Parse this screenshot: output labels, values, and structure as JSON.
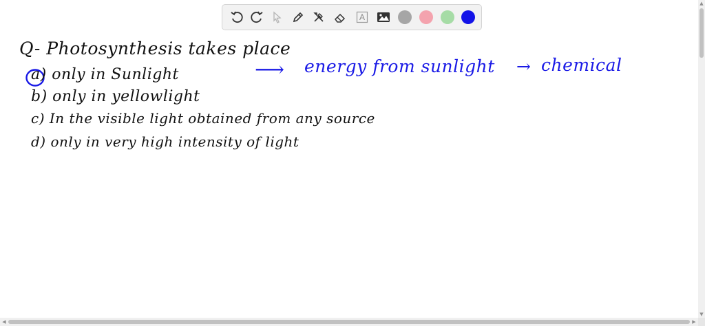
{
  "toolbar": {
    "tools": [
      {
        "name": "undo-icon"
      },
      {
        "name": "redo-icon"
      },
      {
        "name": "pointer-icon"
      },
      {
        "name": "pen-icon"
      },
      {
        "name": "tools-icon"
      },
      {
        "name": "eraser-icon"
      },
      {
        "name": "text-icon",
        "glyph": "A"
      },
      {
        "name": "image-icon"
      }
    ],
    "colors": [
      {
        "name": "color-gray",
        "hex": "#a6a6a6"
      },
      {
        "name": "color-pink",
        "hex": "#f4a3ae"
      },
      {
        "name": "color-green",
        "hex": "#a6dca6"
      },
      {
        "name": "color-blue",
        "hex": "#1313e8",
        "selected": true
      }
    ]
  },
  "notes": {
    "question": "Q- Photosynthesis takes place",
    "options": {
      "a": "a) only in Sunlight",
      "b": "b) only in yellowlight",
      "c": "c) In the visible light obtained from any source",
      "d": "d) only in very high intensity of light"
    },
    "annotation": {
      "arrow1": "⟶",
      "text1": "energy from sunlight",
      "arrow2": "→",
      "text2": "chemical"
    }
  },
  "colors": {
    "ink_black": "#111111",
    "ink_blue": "#1a1ae6"
  }
}
